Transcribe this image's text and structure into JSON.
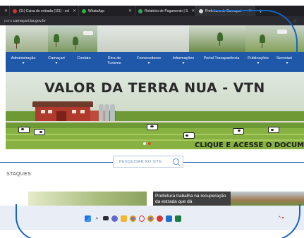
{
  "browser": {
    "tabs": [
      {
        "label": "(11) Caixa de entrada (111) - ecl",
        "fav": "#c73b2e"
      },
      {
        "label": "WhatsApp",
        "fav": "#2bb640"
      },
      {
        "label": "Relatório de Pagamento | S",
        "fav": "#34a853"
      },
      {
        "label": "Prefeitura de Camaçari",
        "fav": "#d9d9d9"
      }
    ],
    "new_tab": "+",
    "url_prefix": "para",
    "url": "camaçari.ba.gov.br"
  },
  "nav": {
    "items": [
      {
        "label": "Administração",
        "sub": "▾"
      },
      {
        "label": "Camaçari",
        "sub": "▾"
      },
      {
        "label": "Contato",
        "sub": ""
      },
      {
        "label": "Dica de Turismo",
        "sub": ""
      },
      {
        "label": "Fornecedores",
        "sub": "▾"
      },
      {
        "label": "Informações",
        "sub": "▾"
      },
      {
        "label": "Portal Transparência",
        "sub": ""
      },
      {
        "label": "Publicações",
        "sub": "▾"
      },
      {
        "label": "Secretari",
        "sub": "▾"
      }
    ]
  },
  "hero": {
    "title": "VALOR DA TERRA NUA - VTN",
    "cta": "CLIQUE E ACESSE O DOCUM",
    "slides": 2,
    "active_slide": 1
  },
  "search": {
    "placeholder": "PESQUISAR NO SITE"
  },
  "section": {
    "title": "STAQUES"
  },
  "news": {
    "headline": "Prefeitura trabalha na recuperação da estrada que dá"
  },
  "taskbar": {
    "icons": [
      "windows-start-icon",
      "search-icon",
      "task-view-icon",
      "chat-icon",
      "file-explorer-icon",
      "chrome-icon",
      "opera-icon",
      "chrome-icon",
      "app-icon",
      "mail-icon",
      "excel-icon"
    ],
    "tray": "^"
  }
}
